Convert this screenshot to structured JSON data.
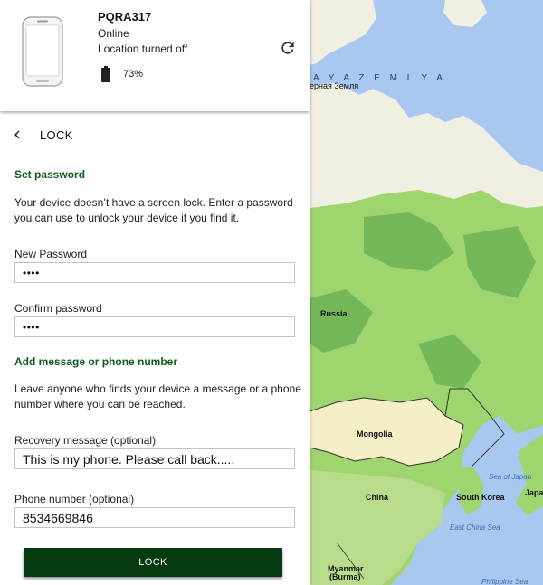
{
  "device": {
    "name": "PQRA317",
    "status": "Online",
    "location": "Location turned off",
    "battery": "73%"
  },
  "lock": {
    "title": "LOCK",
    "set_password": {
      "title": "Set password",
      "description": "Your device doesn’t have a screen lock. Enter a password you can use to unlock your device if you find it.",
      "new_password_label": "New Password",
      "new_password_value": "••••",
      "confirm_password_label": "Confirm password",
      "confirm_password_value": "••••"
    },
    "message": {
      "title": "Add message or phone number",
      "description": "Leave anyone who finds your device a message or a phone number where you can be reached.",
      "recovery_label": "Recovery message (optional)",
      "recovery_value": "This is my phone. Please call back.....",
      "phone_label": "Phone number (optional)",
      "phone_value": "8534669846"
    },
    "button_label": "LOCK"
  },
  "map": {
    "labels": {
      "zemlya": "A Y A   Z E M L Y A",
      "zemlya_ru": "ерная Земля",
      "russia": "Russia",
      "mongolia": "Mongolia",
      "china": "China",
      "south_korea": "South Korea",
      "sea_of_japan": "Sea of Japan",
      "japan": "Japa",
      "east_china_sea": "East China Sea",
      "myanmar": "Myanmar",
      "burma": "(Burma)",
      "philippine_sea": "Philippine Sea"
    }
  },
  "icons": {
    "refresh": "refresh-icon",
    "back": "chevron-left-icon",
    "battery": "battery-icon",
    "phone": "phone-icon"
  },
  "colors": {
    "accent_green": "#0d5b1f",
    "button_green": "#063a10",
    "ocean": "#a9c8f0",
    "land_green": "#9fd56f",
    "land_dark_green": "#74b85a",
    "tundra": "#f1efe2",
    "desert": "#f4efc6"
  }
}
